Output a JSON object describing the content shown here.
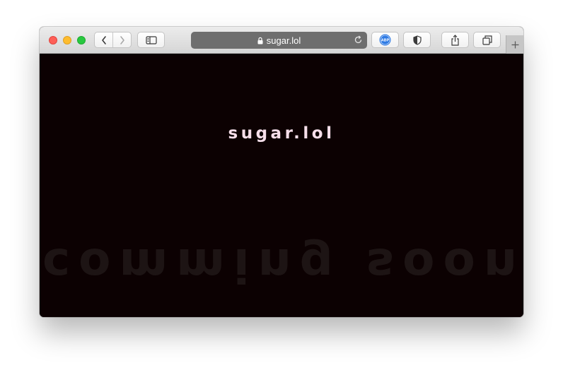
{
  "browser": {
    "address": "sugar.lol",
    "icons": {
      "back": "chevron-left-icon",
      "forward": "chevron-right-icon",
      "sidebar": "sidebar-icon",
      "lock": "lock-icon",
      "reload": "reload-icon",
      "adblock": "adblock-plus-icon",
      "privacy": "shield-icon",
      "share": "share-icon",
      "tabs": "tab-overview-icon",
      "new_tab": "plus-icon"
    }
  },
  "page": {
    "title": "sugar.lol",
    "mirrored_text": "comming soon",
    "colors": {
      "background": "#0c0102",
      "title": "#f6dfea",
      "mirrored_text": "#1d1414"
    }
  }
}
